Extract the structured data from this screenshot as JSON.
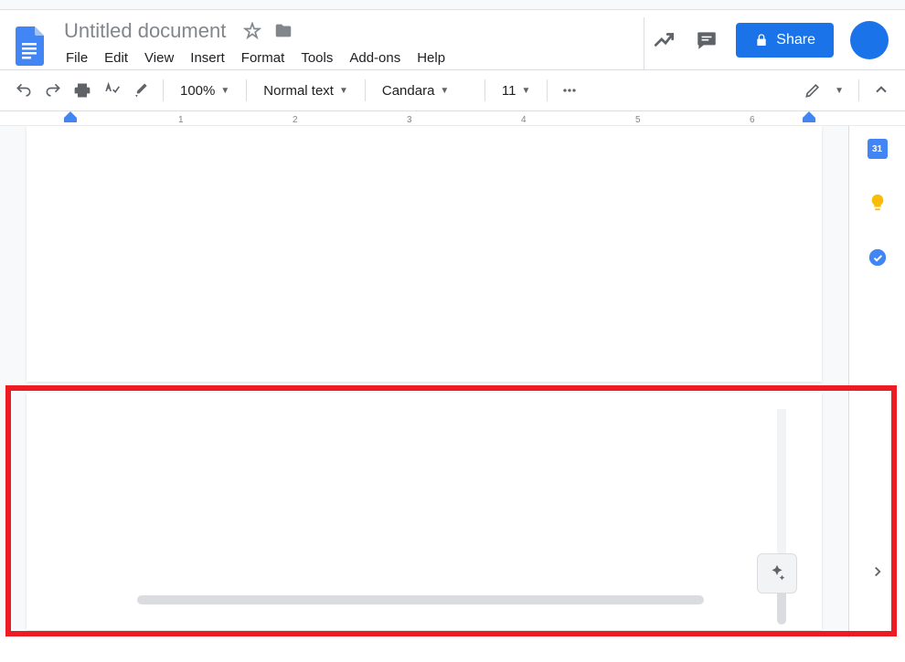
{
  "document": {
    "title": "Untitled document"
  },
  "menu": {
    "file": "File",
    "edit": "Edit",
    "view": "View",
    "insert": "Insert",
    "format": "Format",
    "tools": "Tools",
    "addons": "Add-ons",
    "help": "Help"
  },
  "toolbar": {
    "zoom": "100%",
    "style": "Normal text",
    "font": "Candara",
    "font_size": "11"
  },
  "header": {
    "share_label": "Share"
  },
  "ruler": {
    "marks": [
      "1",
      "2",
      "3",
      "4",
      "5",
      "6"
    ]
  },
  "side_apps": {
    "calendar": "31"
  }
}
